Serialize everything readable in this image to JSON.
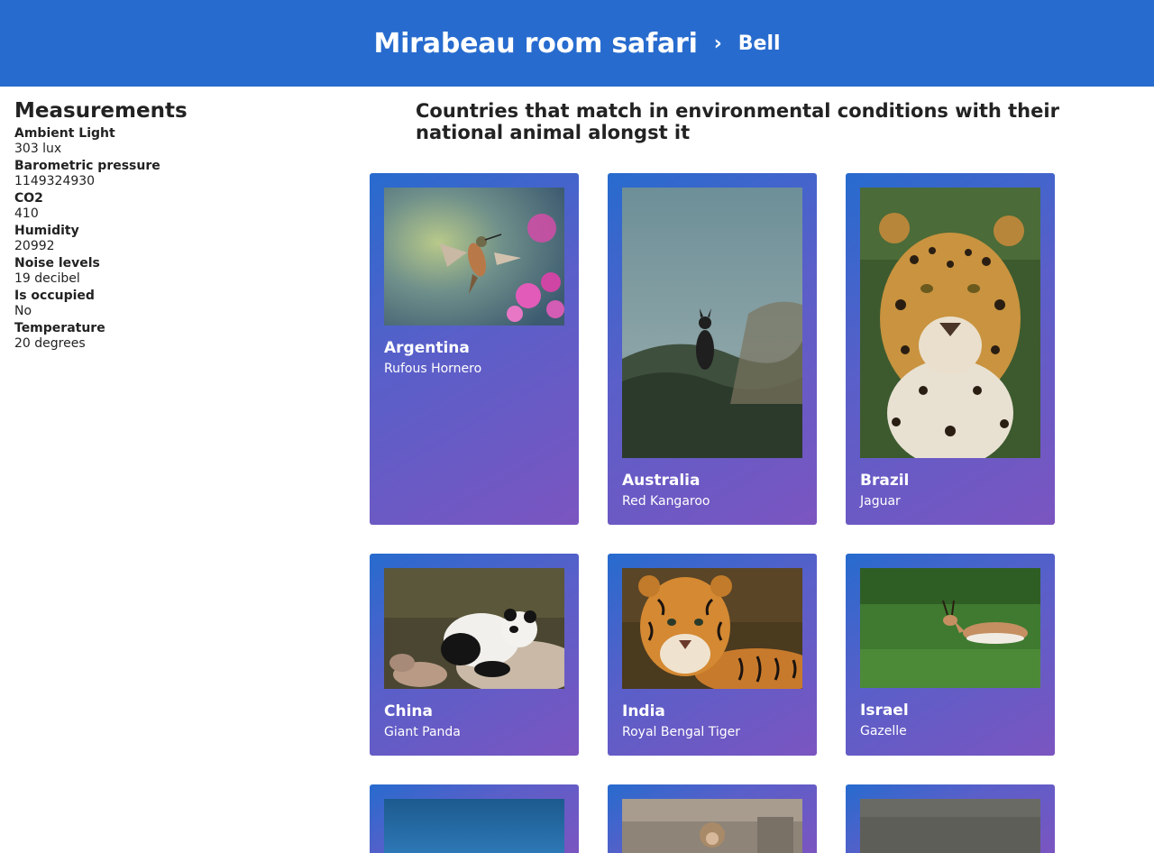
{
  "header": {
    "title": "Mirabeau room safari",
    "separator": "›",
    "crumb": "Bell"
  },
  "sidebar": {
    "title": "Measurements",
    "items": [
      {
        "label": "Ambient Light",
        "value": "303 lux"
      },
      {
        "label": "Barometric pressure",
        "value": "1149324930"
      },
      {
        "label": "CO2",
        "value": "410"
      },
      {
        "label": "Humidity",
        "value": "20992"
      },
      {
        "label": "Noise levels",
        "value": "19 decibel"
      },
      {
        "label": "Is occupied",
        "value": "No"
      },
      {
        "label": "Temperature",
        "value": "20 degrees"
      }
    ]
  },
  "main": {
    "heading": "Countries that match in environmental conditions with their national animal alongst it",
    "cards": [
      {
        "country": "Argentina",
        "animal": "Rufous Hornero",
        "photo": "hummingbird-photo"
      },
      {
        "country": "Australia",
        "animal": "Red Kangaroo",
        "photo": "kangaroo-photo"
      },
      {
        "country": "Brazil",
        "animal": "Jaguar",
        "photo": "jaguar-photo"
      },
      {
        "country": "China",
        "animal": "Giant Panda",
        "photo": "panda-photo"
      },
      {
        "country": "India",
        "animal": "Royal Bengal Tiger",
        "photo": "tiger-photo"
      },
      {
        "country": "Israel",
        "animal": "Gazelle",
        "photo": "gazelle-photo"
      }
    ]
  },
  "colors": {
    "header_bg": "#276bce",
    "card_gradient_start": "#276bce",
    "card_gradient_end": "#7b55c0"
  }
}
